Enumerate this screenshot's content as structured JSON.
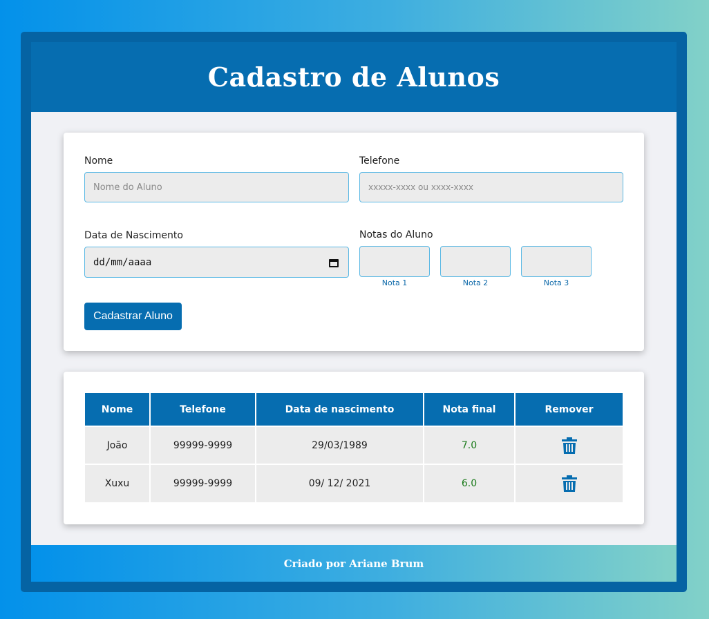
{
  "header": {
    "title": "Cadastro de Alunos"
  },
  "form": {
    "name_label": "Nome",
    "name_placeholder": "Nome do Aluno",
    "phone_label": "Telefone",
    "phone_placeholder": "xxxxx-xxxx ou xxxx-xxxx",
    "birth_label": "Data de Nascimento",
    "birth_value": "dd/mm/aaaa",
    "grades_label": "Notas do Aluno",
    "grade_captions": [
      "Nota 1",
      "Nota 2",
      "Nota 3"
    ],
    "submit_label": "Cadastrar Aluno"
  },
  "table": {
    "columns": [
      "Nome",
      "Telefone",
      "Data de nascimento",
      "Nota final",
      "Remover"
    ],
    "rows": [
      {
        "name": "João",
        "phone": "99999-9999",
        "birth": "29/03/1989",
        "grade": "7.0",
        "remove_icon": "trash-icon"
      },
      {
        "name": "Xuxu",
        "phone": "99999-9999",
        "birth": "09/ 12/ 2021",
        "grade": "6.0",
        "remove_icon": "trash-icon"
      }
    ]
  },
  "footer": {
    "credit": "Criado por Ariane Brum"
  },
  "colors": {
    "primary": "#066db0",
    "frame": "#0563a3",
    "grade_text": "#1a7a1a",
    "input_border": "#5ab8e4"
  }
}
